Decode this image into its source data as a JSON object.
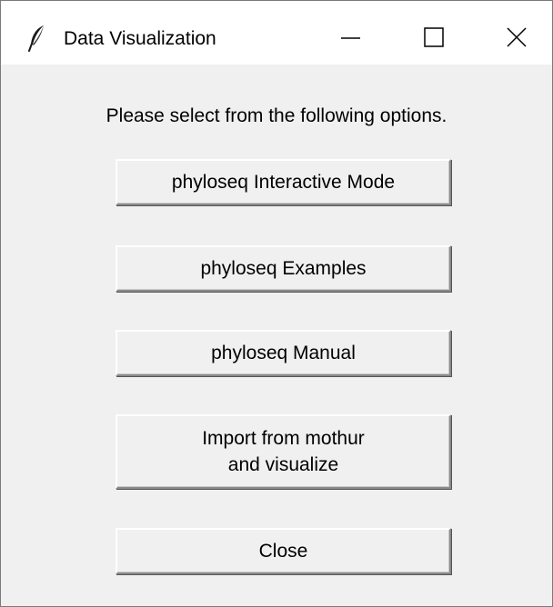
{
  "window": {
    "title": "Data Visualization",
    "icon": "feather-icon",
    "controls": [
      "minimize-icon",
      "maximize-icon",
      "close-icon"
    ]
  },
  "prompt": "Please select from the following options.",
  "buttons": [
    {
      "label": "phyloseq Interactive Mode"
    },
    {
      "label": "phyloseq Examples"
    },
    {
      "label": "phyloseq Manual"
    },
    {
      "label": "Import from mothur\nand visualize"
    },
    {
      "label": "Close"
    }
  ]
}
